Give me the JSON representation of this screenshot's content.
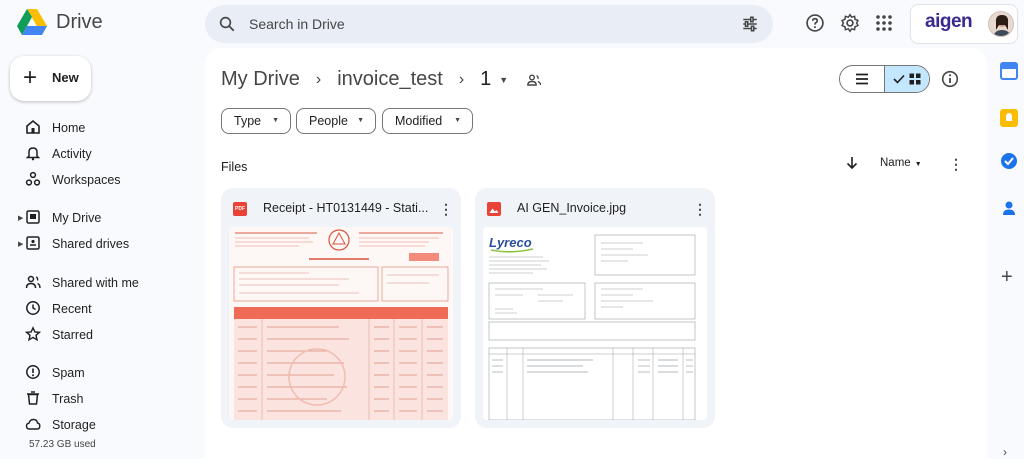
{
  "app": {
    "name": "Drive"
  },
  "search": {
    "placeholder": "Search in Drive"
  },
  "account": {
    "brand": "aigen"
  },
  "sidebar": {
    "new_label": "New",
    "items": [
      {
        "label": "Home",
        "icon": "home-icon"
      },
      {
        "label": "Activity",
        "icon": "bell-icon"
      },
      {
        "label": "Workspaces",
        "icon": "workspaces-icon"
      },
      {
        "label": "My Drive",
        "icon": "my-drive-icon"
      },
      {
        "label": "Shared drives",
        "icon": "shared-drives-icon"
      },
      {
        "label": "Shared with me",
        "icon": "people-icon"
      },
      {
        "label": "Recent",
        "icon": "clock-icon"
      },
      {
        "label": "Starred",
        "icon": "star-icon"
      },
      {
        "label": "Spam",
        "icon": "spam-icon"
      },
      {
        "label": "Trash",
        "icon": "trash-icon"
      },
      {
        "label": "Storage",
        "icon": "cloud-icon"
      }
    ],
    "storage_used": "57.23 GB used"
  },
  "breadcrumb": {
    "root": "My Drive",
    "folder": "invoice_test",
    "subfolder": "1"
  },
  "filters": {
    "type": "Type",
    "people": "People",
    "modified": "Modified"
  },
  "files_section": {
    "label": "Files",
    "sort_label": "Name"
  },
  "files": [
    {
      "name": "Receipt - HT0131449 - Stati...",
      "type_badge": "PDF"
    },
    {
      "name": "AI GEN_Invoice.jpg"
    }
  ],
  "thumbnail": {
    "vendor_logo": "Lyreco"
  },
  "colors": {
    "accent_selected": "#c2e7ff",
    "pdf_red": "#ea4335",
    "main_bg": "#f8fafd"
  }
}
